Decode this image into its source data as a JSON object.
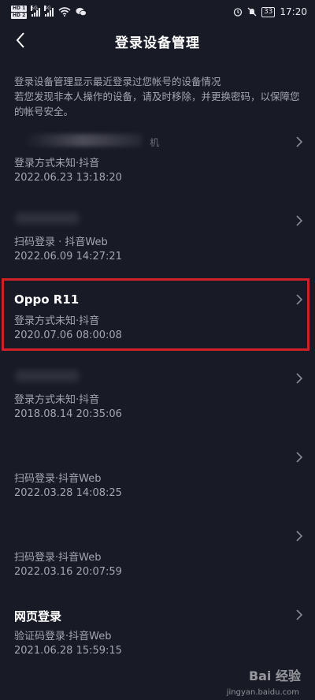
{
  "status_bar": {
    "hd1": "HD 1",
    "hd2": "HD 2",
    "sig1_label": "5G",
    "sig2_label": "4G",
    "battery": "33",
    "time": "17:20",
    "icons": [
      "signal-icon",
      "wifi-icon",
      "wechat-icon",
      "alarm-icon",
      "mute-icon",
      "battery-icon"
    ]
  },
  "nav": {
    "title": "登录设备管理",
    "back_icon": "chevron-left-icon"
  },
  "description": {
    "line1": "登录设备管理显示最近登录过您帐号的设备情况",
    "line2": "若您发现非本人操作的设备，请及时移除，并更换密码，以保障您的帐号安全。"
  },
  "devices": [
    {
      "name": "",
      "name_tail": "机",
      "method": "登录方式未知·抖音",
      "date": "2022.06.23 13:18:20"
    },
    {
      "name": "",
      "name_tail": "",
      "method": "扫码登录 · 抖音Web",
      "date": "2022.06.09 14:27:21"
    },
    {
      "name": "Oppo R11",
      "name_tail": "",
      "method": "登录方式未知·抖音",
      "date": "2020.07.06 08:00:08"
    },
    {
      "name": "",
      "name_tail": "",
      "method": "登录方式未知·抖音",
      "date": "2018.08.14 20:35:06"
    },
    {
      "name": "",
      "name_tail": "",
      "method": "扫码登录·抖音Web",
      "date": "2022.03.28 14:08:25"
    },
    {
      "name": "",
      "name_tail": "",
      "method": "扫码登录·抖音Web",
      "date": "2022.03.16 20:07:59"
    },
    {
      "name": "网页登录",
      "name_tail": "",
      "method": "验证码登录·抖音Web",
      "date": "2021.06.28 15:59:15"
    }
  ],
  "watermark": {
    "brand": "Bai 经验",
    "url": "jingyan.baidu.com"
  },
  "colors": {
    "background": "#181a26",
    "text_primary": "#ffffff",
    "text_secondary": "#a4a6b2",
    "highlight": "#d0202a"
  }
}
